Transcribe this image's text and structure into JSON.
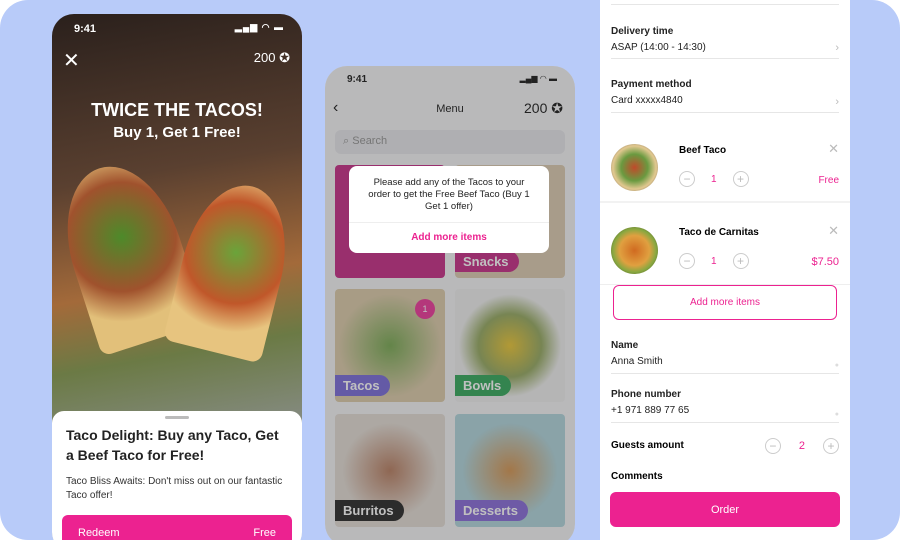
{
  "offer_screen": {
    "time": "9:41",
    "points": "200",
    "headline": "TWICE THE TACOS!",
    "subheadline": "Buy 1, Get 1 Free!",
    "card_title": "Taco Delight: Buy any Taco, Get a Beef Taco for Free!",
    "card_desc": "Taco Bliss Awaits: Don't miss out on our fantastic Taco offer!",
    "redeem_label": "Redeem",
    "redeem_price": "Free"
  },
  "menu_screen": {
    "time": "9:41",
    "title": "Menu",
    "points": "200",
    "search_placeholder": "Search",
    "tiles": [
      {
        "label": "",
        "color": "#c0157a"
      },
      {
        "label": "Snacks",
        "color": "#c0157a"
      },
      {
        "label": "Tacos",
        "color": "#6b5bd6",
        "badge": "1"
      },
      {
        "label": "Bowls",
        "color": "#1e9e4a"
      },
      {
        "label": "Burritos",
        "color": "#111111"
      },
      {
        "label": "Desserts",
        "color": "#7b5bd6"
      }
    ],
    "dialog": {
      "message": "Please add any of the Tacos to your order to get the Free Beef Taco (Buy 1 Get 1 offer)",
      "action": "Add more items"
    }
  },
  "checkout_screen": {
    "delivery_time": {
      "label": "Delivery time",
      "value": "ASAP (14:00 - 14:30)"
    },
    "payment": {
      "label": "Payment method",
      "value": "Card xxxxx4840"
    },
    "items": [
      {
        "name": "Beef Taco",
        "qty": "1",
        "price": "Free"
      },
      {
        "name": "Taco de Carnitas",
        "qty": "1",
        "price": "$7.50"
      }
    ],
    "add_more": "Add more items",
    "name": {
      "label": "Name",
      "value": "Anna Smith"
    },
    "phone": {
      "label": "Phone number",
      "value": "+1 971 889 77 65"
    },
    "guests": {
      "label": "Guests amount",
      "value": "2"
    },
    "comments": {
      "label": "Comments"
    },
    "order": "Order"
  },
  "colors": {
    "accent": "#ec2290",
    "background": "#b8cbf9"
  }
}
